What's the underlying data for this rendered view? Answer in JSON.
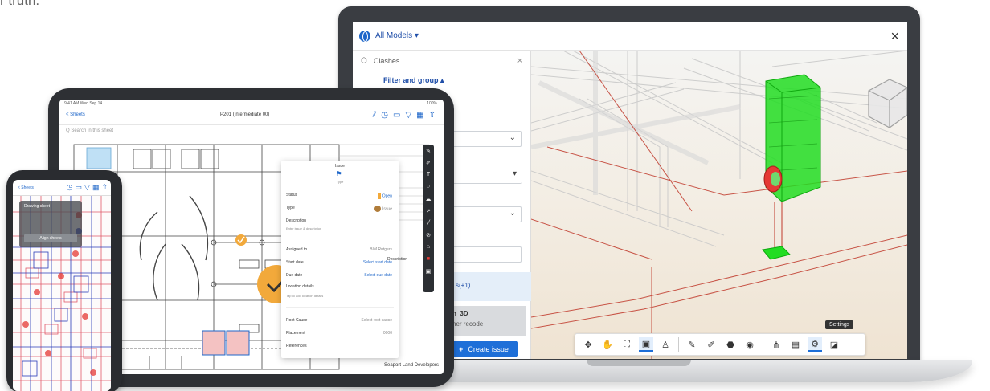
{
  "page": {
    "top_text": "r truth."
  },
  "laptop": {
    "header": {
      "models_label": "All Models",
      "dropdown_marker": "▾",
      "close_label": "×"
    },
    "panel": {
      "clashes_label": "Clashes",
      "clear_label": "×",
      "filter_label": "Filter and group ▴",
      "strip_text": "s(+1)",
      "card_title": "n_3D",
      "card_subtitle": "her recode",
      "create_button": "Create issue",
      "create_plus": "+"
    },
    "viewport": {
      "tooltip": "Settings",
      "toolbar": [
        "orbit-icon",
        "pan-icon",
        "fit-icon",
        "camera-icon",
        "person-icon",
        "pencil-icon",
        "markup-icon",
        "stamp-icon",
        "eye-icon",
        "tree-icon",
        "box-icon",
        "settings-icon",
        "layers-icon"
      ]
    }
  },
  "tablet": {
    "status_left": "9:41 AM   Wed Sep 14",
    "status_right": "100%",
    "back_label": "< Sheets",
    "title": "P201 (Intermediate 00)",
    "search_placeholder": "Q Search in this sheet",
    "issue": {
      "header": "Issue",
      "type_label": "Type",
      "rows": [
        {
          "label": "Status",
          "value": "Open",
          "kind": "status"
        },
        {
          "label": "Type",
          "value": "Issue",
          "kind": "type"
        },
        {
          "label": "Description",
          "value": ""
        },
        {
          "label": "Assigned to",
          "value": "BIM Rutgers"
        },
        {
          "label": "Start date",
          "value": "Select start date"
        },
        {
          "label": "Due date",
          "value": "Select due date"
        },
        {
          "label": "Location details",
          "value": ""
        },
        {
          "label": "Root Cause",
          "value": "Select root cause"
        },
        {
          "label": "Placement",
          "value": "0000"
        },
        {
          "label": "References",
          "value": ""
        }
      ],
      "description_placeholder": "Enter issue & description",
      "location_placeholder": "Tap to add location details"
    },
    "table_header": "Description",
    "footer_text": "Seaport Land Developers"
  },
  "phone": {
    "back_label": "< Sheets",
    "overlay_title": "Drawing sheet",
    "overlay_button": "Align sheets"
  },
  "colors": {
    "accent": "#1e6fd8",
    "clash_green": "#22dd22",
    "clash_red": "#e53935",
    "markup_orange": "#f2a93b"
  }
}
